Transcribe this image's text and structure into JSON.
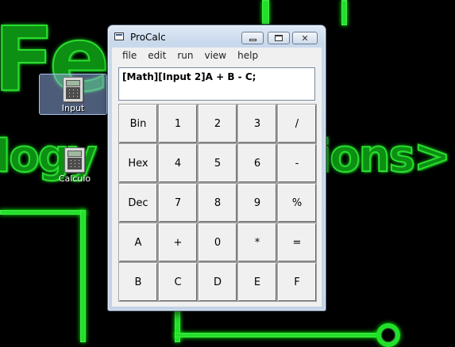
{
  "desktop": {
    "wallpaper_text": {
      "line1": "Fe",
      "line2_left": "logy",
      "line2_right": "ions>"
    },
    "icons": [
      {
        "label": "Input",
        "selected": true
      },
      {
        "label": "Calculo",
        "selected": false
      }
    ]
  },
  "window": {
    "title": "ProCalc",
    "controls": {
      "minimize": "minimize",
      "maximize": "maximize",
      "close": "✕"
    },
    "menu": [
      "file",
      "edit",
      "run",
      "view",
      "help"
    ],
    "display_text": "[Math][Input 2]A + B - C;",
    "keys": [
      [
        "Bin",
        "1",
        "2",
        "3",
        "/"
      ],
      [
        "Hex",
        "4",
        "5",
        "6",
        "-"
      ],
      [
        "Dec",
        "7",
        "8",
        "9",
        "%"
      ],
      [
        "A",
        "+",
        "0",
        "*",
        "="
      ],
      [
        "B",
        "C",
        "D",
        "E",
        "F"
      ]
    ]
  },
  "colors": {
    "wallpaper_bg": "#000000",
    "wallpaper_green": "#22e02a",
    "window_frame": "#c9d9ec"
  }
}
